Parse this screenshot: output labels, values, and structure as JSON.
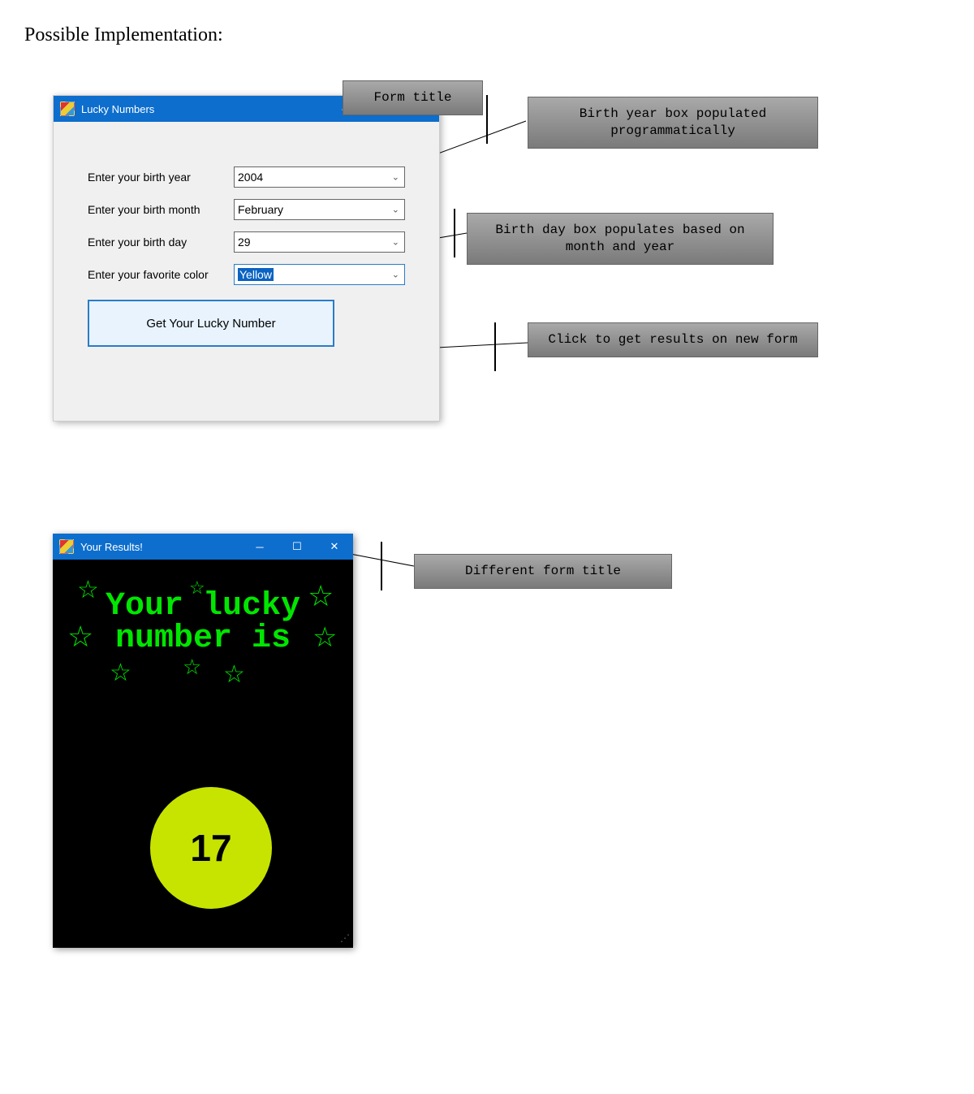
{
  "page_heading": "Possible Implementation:",
  "form1": {
    "title": "Lucky Numbers",
    "labels": {
      "year": "Enter your birth year",
      "month": "Enter your birth month",
      "day": "Enter your birth day",
      "color": "Enter your favorite color"
    },
    "values": {
      "year": "2004",
      "month": "February",
      "day": "29",
      "color": "Yellow"
    },
    "button": "Get Your Lucky Number"
  },
  "form2": {
    "title": "Your Results!",
    "line1": "Your lucky",
    "line2": "number is",
    "result": "17"
  },
  "annotations": {
    "form_title": "Form title",
    "year_box": "Birth year box populated programmatically",
    "day_box": "Birth day box populates based on month and year",
    "click": "Click to get results on new form",
    "diff_title": "Different form title"
  }
}
